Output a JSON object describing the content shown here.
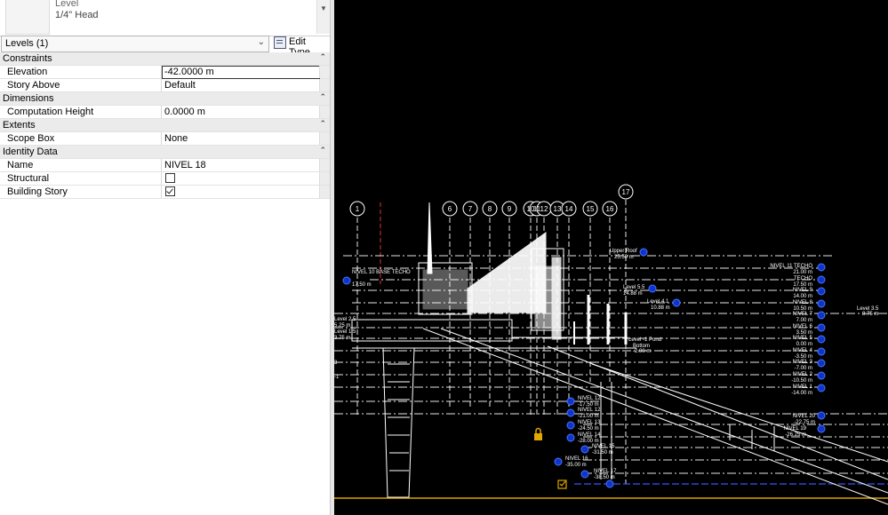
{
  "type_selector": {
    "family": "Level",
    "type": "1/4\" Head"
  },
  "instance": {
    "selector_label": "Levels (1)",
    "edit_type_label": "Edit Type"
  },
  "properties": {
    "constraints": {
      "label": "Constraints",
      "elevation_label": "Elevation",
      "elevation_value": "-42.0000 m",
      "story_above_label": "Story Above",
      "story_above_value": "Default"
    },
    "dimensions": {
      "label": "Dimensions",
      "computation_height_label": "Computation Height",
      "computation_height_value": "0.0000 m"
    },
    "extents": {
      "label": "Extents",
      "scope_box_label": "Scope Box",
      "scope_box_value": "None"
    },
    "identity": {
      "label": "Identity Data",
      "name_label": "Name",
      "name_value": "NIVEL 18",
      "structural_label": "Structural",
      "structural_checked": false,
      "building_story_label": "Building Story",
      "building_story_checked": true
    }
  },
  "view": {
    "background": "#000000",
    "grid_bubbles": [
      "1",
      "6",
      "7",
      "8",
      "9",
      "10",
      "11",
      "12",
      "13",
      "14",
      "15",
      "16",
      "17"
    ],
    "level_labels": {
      "nivel_10": "NIVEL 10 BASE TECHO",
      "nivel_10_elev": "17.50 m",
      "upper_roof": "Upper Roof",
      "upper_roof_elev": "25.50 m",
      "level_55": "Level 5.5",
      "level_55_elev": "14.88 m",
      "level_41": "Level 4.1",
      "level_41_elev": "10.88 m",
      "level_m1_pond": "Level -1 Pond",
      "bottom": "Bottom",
      "bottom_elev": "-2.00 m",
      "level_25": "Level 2.5",
      "level_25_elev": "5.25 m",
      "level_15": "Level 1.5",
      "level_15_elev": "3.75 m",
      "level_35": "Level 3.5",
      "level_35_elev": "8.75 m",
      "nivel_11": "NIVEL 11 TECHO",
      "nivel_11_elev": "21.00 m",
      "techo": "TECHO",
      "techo_elev": "17.50 m",
      "nivel_9": "NIVEL 9",
      "nivel_9_elev": "14.00 m",
      "nivel_8": "NIVEL 8",
      "nivel_8_elev": "10.50 m",
      "nivel_7": "NIVEL 7",
      "nivel_7_elev": "7.00 m",
      "nivel_6": "NIVEL 6",
      "nivel_6_elev": "3.50 m",
      "nivel_5": "NIVEL 5",
      "nivel_5_elev": "0.00 m",
      "nivel_4": "NIVEL 4",
      "nivel_4_elev": "-3.50 m",
      "nivel_3": "NIVEL 3",
      "nivel_3_elev": "-7.00 m",
      "nivel_2": "NIVEL 2",
      "nivel_2_elev": "-10.50 m",
      "nivel_1": "NIVEL 1",
      "nivel_1_elev": "-14.00 m",
      "nivel_12": "NIVEL 12",
      "nivel_12_elev": "-17.50 m",
      "nivel_12b": "NIVEL 12",
      "nivel_12b_elev": "-21.00 m",
      "nivel_13": "NIVEL 13",
      "nivel_13_elev": "-24.50 m",
      "nivel_14": "NIVEL 14",
      "nivel_14_elev": "-28.00 m",
      "nivel_15": "NIVEL 15",
      "nivel_15_elev": "-31.50 m",
      "nivel_16": "NIVEL 16",
      "nivel_16_elev": "-35.00 m",
      "nivel_17": "NIVEL 17",
      "nivel_17_elev": "-38.50 m",
      "nivel_20": "NIVEL 20",
      "nivel_20_elev": "-22.75 m",
      "nivel_19": "NIVEL 19",
      "nivel_19_elev": "-26.25 m",
      "left_3": "3",
      "left_m1": "-1"
    }
  }
}
